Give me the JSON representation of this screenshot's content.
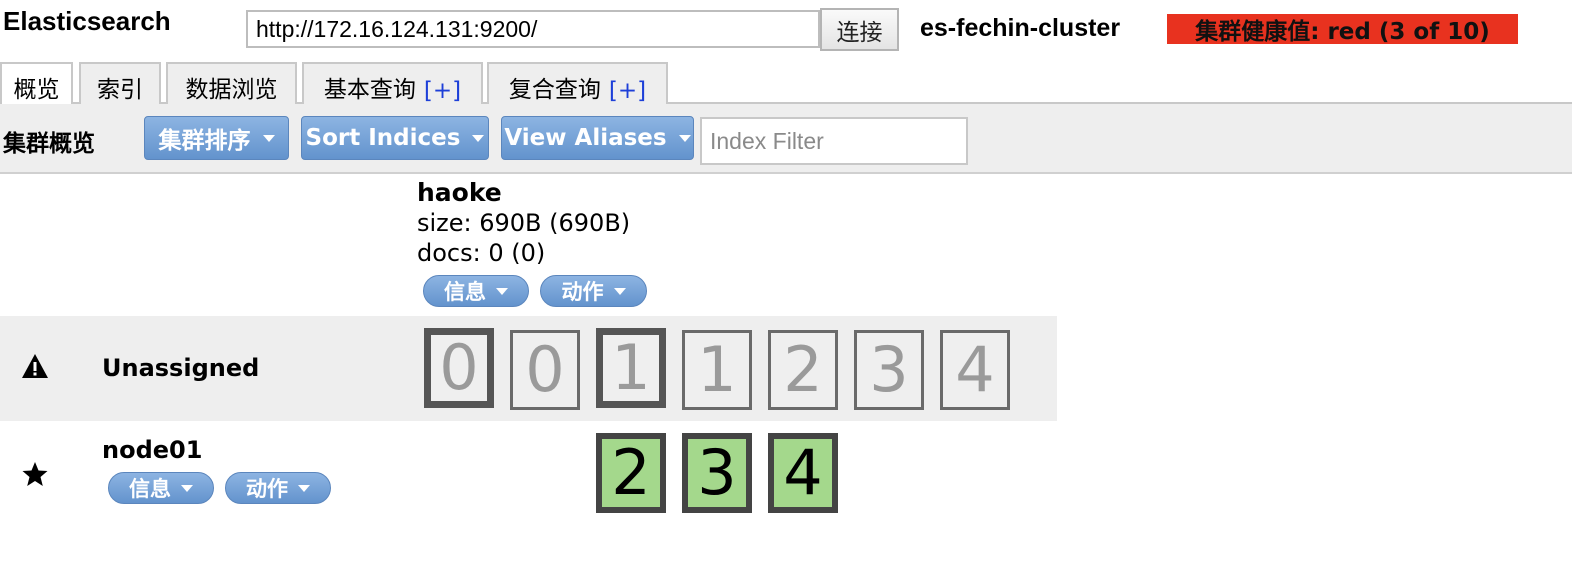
{
  "header": {
    "app_title": "Elasticsearch",
    "url_value": "http://172.16.124.131:9200/",
    "connect_label": "连接",
    "cluster_name": "es-fechin-cluster",
    "health_text": "集群健康值: red (3 of 10)",
    "health_color": "#e8321f"
  },
  "tabs": [
    {
      "label": "概览",
      "plus": "",
      "active": true
    },
    {
      "label": "索引",
      "plus": "",
      "active": false
    },
    {
      "label": "数据浏览",
      "plus": "",
      "active": false
    },
    {
      "label": "基本查询",
      "plus": "[+]",
      "active": false
    },
    {
      "label": "复合查询",
      "plus": "[+]",
      "active": false
    }
  ],
  "toolbar": {
    "title": "集群概览",
    "sort_cluster_label": "集群排序",
    "sort_indices_label": "Sort Indices",
    "view_aliases_label": "View Aliases",
    "filter_placeholder": "Index Filter"
  },
  "index": {
    "name": "haoke",
    "size_text": "size: 690B (690B)",
    "docs_text": "docs: 0 (0)",
    "info_label": "信息",
    "action_label": "动作"
  },
  "unassigned": {
    "label": "Unassigned",
    "icon": "warning-icon",
    "shards": [
      "0",
      "0",
      "1",
      "1",
      "2",
      "3",
      "4"
    ]
  },
  "node": {
    "name": "node01",
    "icon": "star-icon",
    "info_label": "信息",
    "action_label": "动作",
    "shards": [
      "2",
      "3",
      "4"
    ],
    "shard_color": "#a4d88c"
  }
}
